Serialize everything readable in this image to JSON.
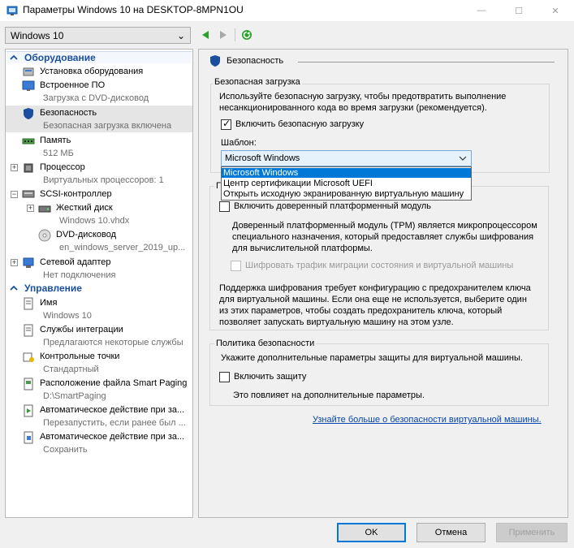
{
  "window": {
    "title": "Параметры Windows 10 на DESKTOP-8MPN1OU",
    "min": "—",
    "max": "☐",
    "close": "✕"
  },
  "vm_select": {
    "value": "Windows 10",
    "arrow": "⌄"
  },
  "nav": {
    "back": "◀",
    "forward": "▶",
    "refresh": "↻"
  },
  "sidebar": {
    "hardware_header": "Оборудование",
    "management_header": "Управление",
    "items": [
      {
        "label": "Установка оборудования",
        "sub": ""
      },
      {
        "label": "Встроенное ПО",
        "sub": "Загрузка с DVD-дисковод"
      },
      {
        "label": "Безопасность",
        "sub": "Безопасная загрузка включена"
      },
      {
        "label": "Память",
        "sub": "512 МБ"
      },
      {
        "label": "Процессор",
        "sub": "Виртуальных процессоров: 1"
      },
      {
        "label": "SCSI-контроллер",
        "sub": ""
      },
      {
        "label": "Жесткий диск",
        "sub": "Windows 10.vhdx"
      },
      {
        "label": "DVD-дисковод",
        "sub": "en_windows_server_2019_up..."
      },
      {
        "label": "Сетевой адаптер",
        "sub": "Нет подключения"
      },
      {
        "label": "Имя",
        "sub": "Windows 10"
      },
      {
        "label": "Службы интеграции",
        "sub": "Предлагаются некоторые службы"
      },
      {
        "label": "Контрольные точки",
        "sub": "Стандартный"
      },
      {
        "label": "Расположение файла Smart Paging",
        "sub": "D:\\SmartPaging"
      },
      {
        "label": "Автоматическое действие при за...",
        "sub": "Перезапустить, если ранее был ..."
      },
      {
        "label": "Автоматическое действие при за...",
        "sub": "Сохранить"
      }
    ],
    "expander": "+",
    "collapser": "−"
  },
  "panel": {
    "title": "Безопасность",
    "secure_boot": {
      "group_title": "Безопасная загрузка",
      "description": "Используйте безопасную загрузку, чтобы предотвратить выполнение несанкционированного кода во время загрузки (рекомендуется).",
      "checkbox_label": "Включить безопасную загрузку",
      "checked": true,
      "template_label": "Шаблон:",
      "template_value": "Microsoft Windows",
      "options": [
        "Microsoft Windows",
        "Центр сертификации Microsoft UEFI",
        "Открыть исходную экранированную виртуальную машину"
      ]
    },
    "encryption": {
      "group_title_fragment": "Г",
      "tpm_label": "Включить доверенный платформенный модуль",
      "tpm_description": "Доверенный платформенный модуль (TPM) является микропроцессором специального назначения, который предоставляет службы шифрования для вычислительной платформы.",
      "migration_label": "Шифровать трафик миграции состояния и виртуальной машины",
      "support_note": "Поддержка шифрования требует конфигурацию с предохранителем ключа для виртуальной машины. Если она еще не используется, выберите один из этих параметров, чтобы создать предохранитель ключа, который позволяет запускать виртуальную машину на этом узле."
    },
    "policy": {
      "group_title": "Политика безопасности",
      "description": "Укажите дополнительные параметры защиты для виртуальной машины.",
      "checkbox_label": "Включить защиту",
      "note": "Это повлияет на дополнительные параметры."
    },
    "link": "Узнайте больше о безопасности виртуальной машины."
  },
  "buttons": {
    "ok": "OK",
    "cancel": "Отмена",
    "apply": "Применить"
  },
  "colors": {
    "accent": "#0078d7",
    "section_header": "#1a4f9f",
    "link": "#0645ad"
  }
}
